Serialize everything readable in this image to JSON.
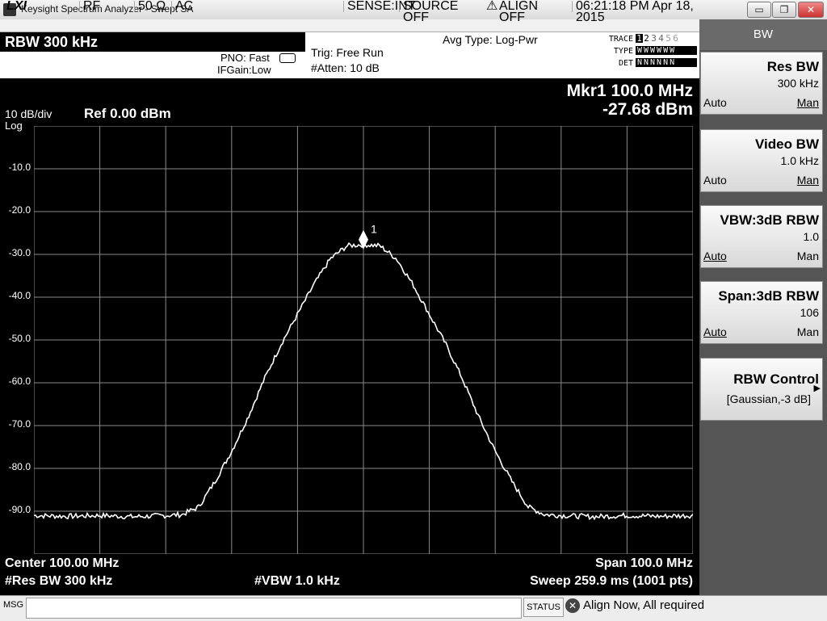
{
  "window": {
    "title": "Keysight Spectrum Analyzer - Swept SA",
    "lxi": "LXI",
    "minimize": "▭",
    "restore": "❐",
    "close": "✕"
  },
  "status_row": {
    "rf": "RF",
    "impedance": "50 Ω",
    "coupling": "AC",
    "sense": "SENSE:INT",
    "source": "SOURCE OFF",
    "align": "ALIGN OFF",
    "datetime": "06:21:18 PM Apr 18, 2015"
  },
  "header": {
    "rbw": "RBW 300 kHz",
    "pno": "PNO: Fast",
    "ifgain": "IFGain:Low",
    "trig": "Trig: Free Run",
    "atten": "#Atten: 10 dB",
    "avg_type": "Avg Type: Log-Pwr",
    "trace_label": "TRACE",
    "type_label": "TYPE",
    "det_label": "DET",
    "trace_nums": [
      "1",
      "2",
      "3",
      "4",
      "5",
      "6"
    ],
    "type_vals": "WWWWWW",
    "det_vals": "NNNNNN"
  },
  "display": {
    "scale": "10 dB/div",
    "ref": "Ref 0.00 dBm",
    "log": "Log",
    "marker_freq": "Mkr1 100.0 MHz",
    "marker_amp": "-27.68 dBm",
    "marker_label": "1",
    "center": "Center 100.00 MHz",
    "res_bw": "#Res BW 300 kHz",
    "vbw": "#VBW 1.0 kHz",
    "span": "Span 100.0 MHz",
    "sweep": "Sweep  259.9 ms (1001 pts)"
  },
  "chart_data": {
    "type": "line",
    "xlabel": "",
    "ylabel": "",
    "x_range_mhz": [
      50,
      150
    ],
    "ylim": [
      -100,
      0
    ],
    "y_tick_labels": [
      "-10.0",
      "-20.0",
      "-30.0",
      "-40.0",
      "-50.0",
      "-60.0",
      "-70.0",
      "-80.0",
      "-90.0"
    ],
    "grid": true,
    "series": [
      {
        "x": [
          50,
          55,
          60,
          65,
          70,
          72.5,
          75,
          77.5,
          80,
          82.5,
          85,
          87.5,
          90,
          92.5,
          95,
          97.5,
          100,
          102.5,
          105,
          107.5,
          110,
          112.5,
          115,
          117.5,
          120,
          122.5,
          125,
          127.5,
          130,
          135,
          140,
          145,
          150
        ],
        "values": [
          -91,
          -91.2,
          -91,
          -91.3,
          -91,
          -90.8,
          -89,
          -83,
          -76,
          -68,
          -59,
          -51,
          -44,
          -37,
          -31,
          -28,
          -27.7,
          -28,
          -31,
          -37,
          -44,
          -51,
          -59,
          -68,
          -76,
          -83,
          -89,
          -90.8,
          -91,
          -91.3,
          -91,
          -91.2,
          -91
        ]
      }
    ],
    "marker": {
      "x": 100,
      "y": -27.68
    }
  },
  "softkeys": {
    "menu_title": "BW",
    "res_bw": {
      "label": "Res BW",
      "value": "300 kHz",
      "auto": "Auto",
      "man": "Man"
    },
    "video_bw": {
      "label": "Video BW",
      "value": "1.0 kHz",
      "auto": "Auto",
      "man": "Man"
    },
    "vbw_rbw": {
      "label": "VBW:3dB RBW",
      "value": "1.0",
      "auto": "Auto",
      "man": "Man"
    },
    "span_rbw": {
      "label": "Span:3dB RBW",
      "value": "106",
      "auto": "Auto",
      "man": "Man"
    },
    "rbw_control": {
      "label": "RBW Control",
      "value": "[Gaussian,-3 dB]"
    }
  },
  "bottom": {
    "msg": "MSG",
    "status": "STATUS",
    "message": "Align Now, All required"
  }
}
